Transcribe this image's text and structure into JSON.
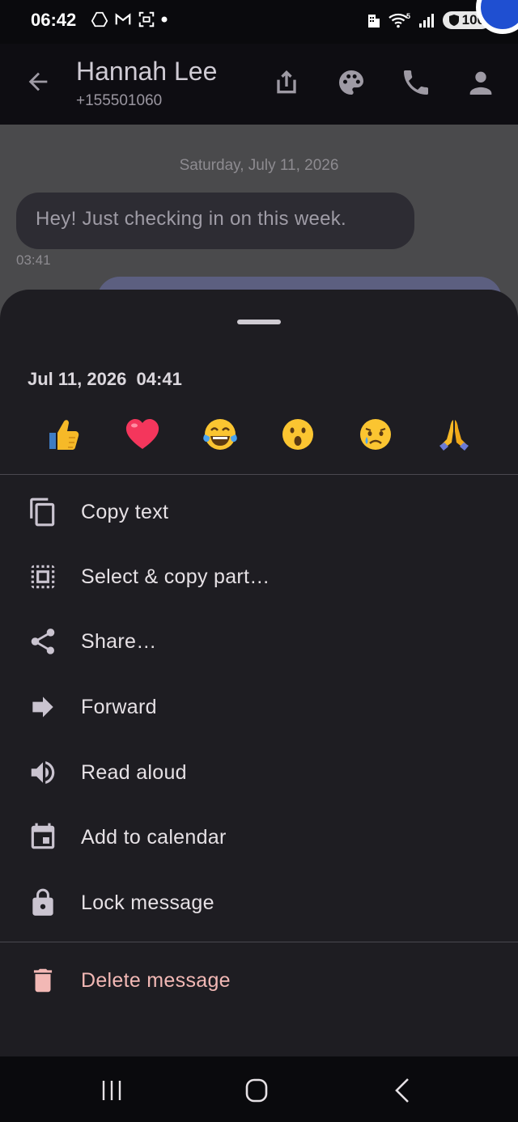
{
  "status_bar": {
    "time": "06:42",
    "battery": "100",
    "wifi_label": "5"
  },
  "header": {
    "contact_name": "Hannah Lee",
    "contact_phone": "+155501060"
  },
  "conversation": {
    "date_separator": "Saturday, July 11, 2026",
    "incoming_message": "Hey! Just checking in on this week.",
    "incoming_time": "03:41"
  },
  "sheet": {
    "message_datetime": "Jul 11, 2026  04:41",
    "reactions": [
      "👍",
      "❤️",
      "😂",
      "😮",
      "😢",
      "🙏"
    ],
    "menu": [
      {
        "label": "Copy text",
        "icon": "copy-icon"
      },
      {
        "label": "Select & copy part…",
        "icon": "select-all-icon"
      },
      {
        "label": "Share…",
        "icon": "share-icon"
      },
      {
        "label": "Forward",
        "icon": "forward-arrow-icon"
      },
      {
        "label": "Read aloud",
        "icon": "speaker-icon"
      },
      {
        "label": "Add to calendar",
        "icon": "calendar-icon"
      },
      {
        "label": "Lock message",
        "icon": "lock-icon"
      }
    ],
    "delete_label": "Delete message"
  },
  "colors": {
    "sheet_bg": "#1e1d22",
    "danger": "#f2b8b5",
    "outgoing_bubble": "#5c5f80"
  }
}
